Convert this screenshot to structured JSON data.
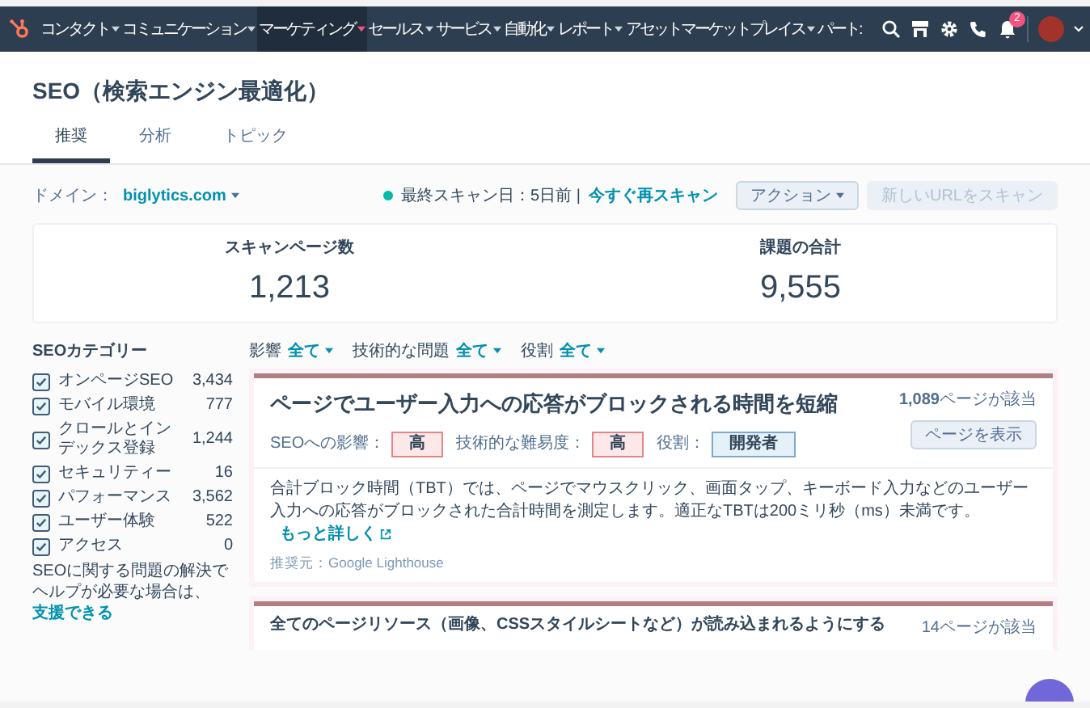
{
  "nav": {
    "items": [
      {
        "label": "コンタクト",
        "selected": false
      },
      {
        "label": "コミュニケーション",
        "selected": false
      },
      {
        "label": "マーケティング",
        "selected": true
      },
      {
        "label": "セールス",
        "selected": false
      },
      {
        "label": "サービス",
        "selected": false
      },
      {
        "label": "自動化",
        "selected": false
      },
      {
        "label": "レポート",
        "selected": false
      },
      {
        "label": "アセットマーケットプレイス",
        "selected": false
      },
      {
        "label": "パート:",
        "selected": false
      }
    ],
    "notification_count": "2"
  },
  "page": {
    "title": "SEO（検索エンジン最適化）",
    "tabs": [
      {
        "label": "推奨",
        "selected": true
      },
      {
        "label": "分析",
        "selected": false
      },
      {
        "label": "トピック",
        "selected": false
      }
    ]
  },
  "domain_bar": {
    "label": "ドメイン：",
    "domain": "biglytics.com",
    "last_scan": "最終スキャン日：5日前 |",
    "rescan_link": "今すぐ再スキャン",
    "actions_button": "アクション",
    "scan_button": {
      "label": "新しいURLをスキャン",
      "disabled": true
    }
  },
  "stats": [
    {
      "label": "スキャンページ数",
      "value": "1,213"
    },
    {
      "label": "課題の合計",
      "value": "9,555"
    }
  ],
  "sidebar": {
    "title": "SEOカテゴリー",
    "categories": [
      {
        "label": "オンページSEO",
        "count": "3,434",
        "checked": true
      },
      {
        "label": "モバイル環境",
        "count": "777",
        "checked": true
      },
      {
        "label": "クロールとインデックス登録",
        "count": "1,244",
        "checked": true
      },
      {
        "label": "セキュリティー",
        "count": "16",
        "checked": true
      },
      {
        "label": "パフォーマンス",
        "count": "3,562",
        "checked": true
      },
      {
        "label": "ユーザー体験",
        "count": "522",
        "checked": true
      },
      {
        "label": "アクセス",
        "count": "0",
        "checked": true
      }
    ],
    "help_text": "SEOに関する問題の解決でヘルプが必要な場合は、",
    "help_link": "支援できる"
  },
  "filters": [
    {
      "label": "影響",
      "value": "全て"
    },
    {
      "label": "技術的な問題",
      "value": "全て"
    },
    {
      "label": "役割",
      "value": "全て"
    }
  ],
  "recommendations": [
    {
      "title": "ページでユーザー入力への応答がブロックされる時間を短縮",
      "pages": "**1,089**ページが該当",
      "view_button": "ページを表示",
      "tags": [
        {
          "label": "SEOへの影響：",
          "value": "高",
          "kind": "high"
        },
        {
          "label": "技術的な難易度：",
          "value": "高",
          "kind": "high"
        },
        {
          "label": "役割：",
          "value": "開発者",
          "kind": "role"
        }
      ],
      "description": "合計ブロック時間（TBT）では、ページでマウスクリック、画面タップ、キーボード入力などのユーザー入力への応答がブロックされた合計時間を測定します。適正なTBTは200ミリ秒（ms）未満です。",
      "more_link": "もっと詳しく",
      "source": "推奨元：Google Lighthouse"
    },
    {
      "title": "全てのページリソース（画像、CSSスタイルシートなど）が読み込まれるようにする",
      "pages": "14ページが該当"
    }
  ]
}
